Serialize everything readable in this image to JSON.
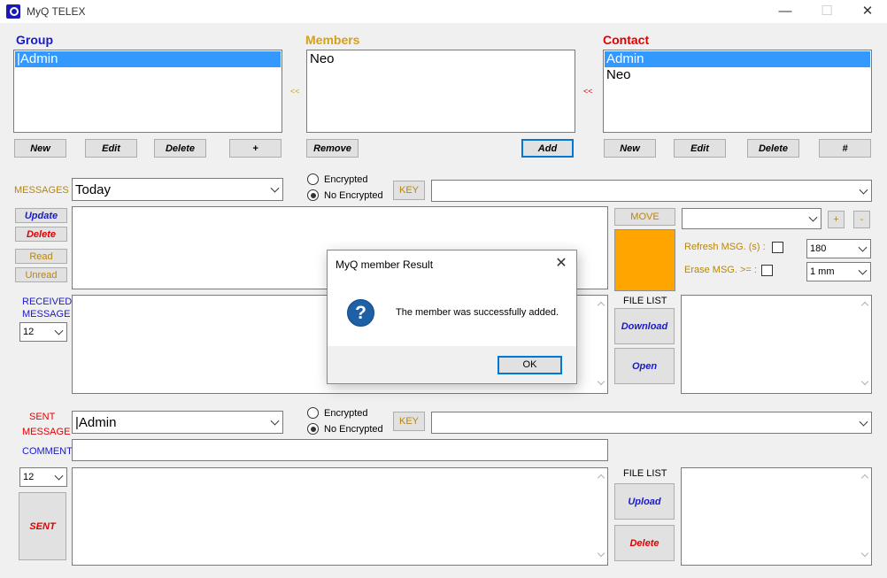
{
  "window": {
    "title": "MyQ TELEX",
    "controls": {
      "minimize": "—",
      "maximize": "☐",
      "close": "✕"
    }
  },
  "colors": {
    "group_label": "#1a1ac8",
    "members_label": "#d4a017",
    "contact_label": "#e00000",
    "selection": "#3399ff",
    "orange_panel": "#ffa500"
  },
  "group": {
    "label": "Group",
    "items": [
      "|Admin"
    ],
    "buttons": {
      "new": "New",
      "edit": "Edit",
      "delete": "Delete",
      "plus": "+"
    }
  },
  "members": {
    "label": "Members",
    "items": [
      "Neo"
    ],
    "arrow_left": "<<",
    "arrow_right": "<<",
    "buttons": {
      "remove": "Remove",
      "add": "Add"
    }
  },
  "contact": {
    "label": "Contact",
    "items": [
      "Admin",
      "Neo"
    ],
    "buttons": {
      "new": "New",
      "edit": "Edit",
      "delete": "Delete",
      "hash": "#"
    }
  },
  "messages": {
    "label": "MESSAGES",
    "filter_value": "Today",
    "encrypted_label": "Encrypted",
    "no_encrypted_label": "No Encrypted",
    "key_button": "KEY",
    "buttons": {
      "update": "Update",
      "delete": "Delete",
      "read": "Read",
      "unread": "Unread"
    },
    "move_button": "MOVE",
    "plus": "+",
    "minus": "-",
    "refresh_label": "Refresh MSG. (s) :",
    "refresh_value": "180",
    "erase_label": "Erase MSG. >= :",
    "erase_value": "1 mm"
  },
  "received": {
    "label_line1": "RECEIVED",
    "label_line2": "MESSAGE",
    "font_size": "12",
    "file_list_label": "FILE LIST",
    "download_button": "Download",
    "open_button": "Open"
  },
  "sent": {
    "label_line1": "SENT",
    "label_line2": "MESSAGE",
    "recipient": "|Admin",
    "encrypted_label": "Encrypted",
    "no_encrypted_label": "No Encrypted",
    "key_button": "KEY",
    "comment_label": "COMMENT",
    "font_size": "12",
    "sent_button": "SENT",
    "file_list_label": "FILE LIST",
    "upload_button": "Upload",
    "delete_button": "Delete"
  },
  "dialog": {
    "title": "MyQ member Result",
    "close": "✕",
    "icon": "?",
    "message": "The member was successfully added.",
    "ok_button": "OK"
  }
}
